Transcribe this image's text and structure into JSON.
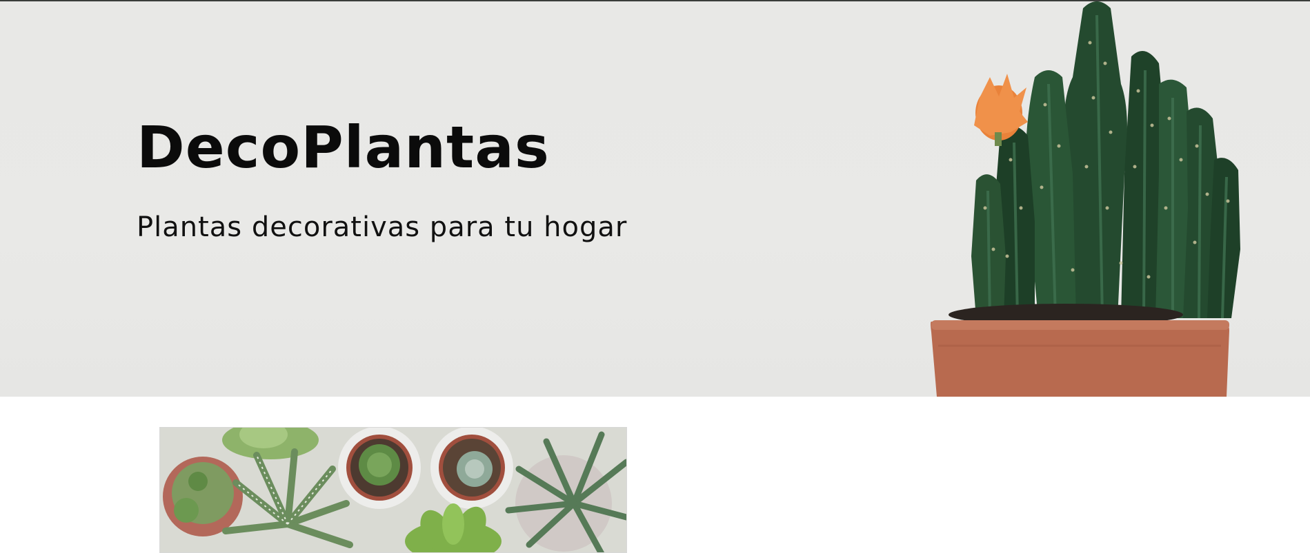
{
  "site": {
    "title": "DecoPlantas",
    "tagline": "Plantas decorativas para tu hogar"
  },
  "hero": {
    "background_color": "#e9e9e7",
    "image_icon": "cactus-in-terracotta-pot-icon",
    "pot_color": "#b86a4f",
    "flower_color": "#e9823a"
  },
  "gallery": {
    "image_icon": "succulents-in-pots-icon"
  }
}
